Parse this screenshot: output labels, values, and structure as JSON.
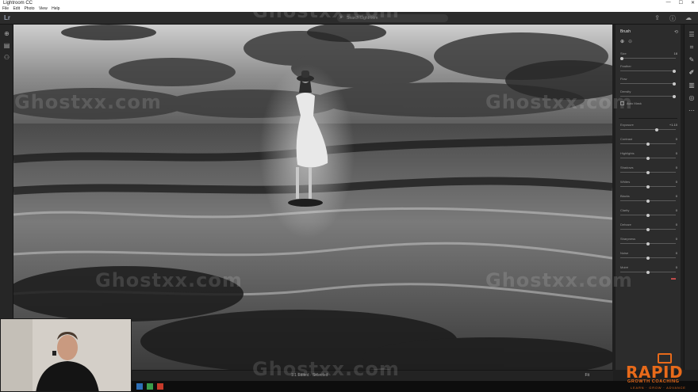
{
  "window": {
    "title": "Lightroom CC",
    "menu": [
      "File",
      "Edit",
      "Photo",
      "View",
      "Help"
    ],
    "controls": [
      "—",
      "☐",
      "✕"
    ]
  },
  "appbar": {
    "logo": "Lr",
    "search_placeholder": "Search Lightroom"
  },
  "edit_panel": {
    "title": "Brush",
    "brush_sliders": [
      {
        "label": "Size",
        "value": "18"
      },
      {
        "label": "Feather",
        "value": ""
      },
      {
        "label": "Flow",
        "value": ""
      },
      {
        "label": "Density",
        "value": ""
      }
    ],
    "auto_mask_label": "Auto Mask",
    "adjust_sliders": [
      {
        "label": "Exposure",
        "value": "+1.10",
        "level": 0.66
      },
      {
        "label": "Contrast",
        "value": "0",
        "level": 0.5
      },
      {
        "label": "Highlights",
        "value": "0",
        "level": 0.5
      },
      {
        "label": "Shadows",
        "value": "0",
        "level": 0.5
      },
      {
        "label": "Whites",
        "value": "0",
        "level": 0.5
      },
      {
        "label": "Blacks",
        "value": "0",
        "level": 0.5
      },
      {
        "label": "Clarity",
        "value": "0",
        "level": 0.5
      },
      {
        "label": "Dehaze",
        "value": "0",
        "level": 0.5
      },
      {
        "label": "Sharpness",
        "value": "0",
        "level": 0.5
      },
      {
        "label": "Noise",
        "value": "0",
        "level": 0.5
      },
      {
        "label": "Moiré",
        "value": "0",
        "level": 0.5
      }
    ]
  },
  "filmstrip": {
    "info": "1/1 Edited · Selected",
    "zoom": "Fit"
  },
  "watermarks": [
    "Ghostxx.com",
    "Ghostxx.com",
    "Ghostxx.com",
    "Ghostxx.com",
    "Ghostxx.com",
    "Ghostxx.com"
  ],
  "branding": {
    "main": "RAPID",
    "sub": "GROWTH COACHING",
    "tag": "LEARN · GROW · ADVANCE"
  },
  "colors": {
    "brand_orange": "#e86a1a",
    "panel_bg": "#2c2c2c",
    "app_bg": "#1f1f1f"
  }
}
